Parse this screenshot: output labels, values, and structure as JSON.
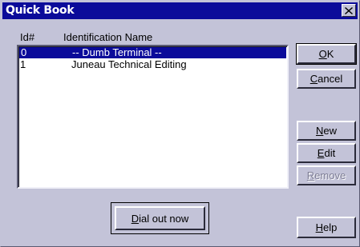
{
  "window": {
    "title": "Quick Book",
    "close_glyph": "✕"
  },
  "columns": {
    "id_header": "Id#",
    "name_header": "Identification Name"
  },
  "entries": [
    {
      "id": "0",
      "name": "-- Dumb Terminal --",
      "selected": true
    },
    {
      "id": "1",
      "name": "Juneau Technical Editing",
      "selected": false
    }
  ],
  "buttons": {
    "ok": {
      "mnemonic": "O",
      "rest": "K"
    },
    "cancel": {
      "mnemonic": "C",
      "rest": "ancel"
    },
    "new": {
      "mnemonic": "N",
      "rest": "ew"
    },
    "edit": {
      "mnemonic": "E",
      "rest": "dit"
    },
    "remove": {
      "mnemonic": "R",
      "rest": "emove",
      "disabled": true
    },
    "dial": {
      "mnemonic": "D",
      "rest": "ial out now"
    },
    "help": {
      "mnemonic": "H",
      "rest": "elp"
    }
  },
  "colors": {
    "titlebar": "#0b0b9a",
    "face": "#c3c3d8",
    "selection": "#0b0b9a"
  }
}
